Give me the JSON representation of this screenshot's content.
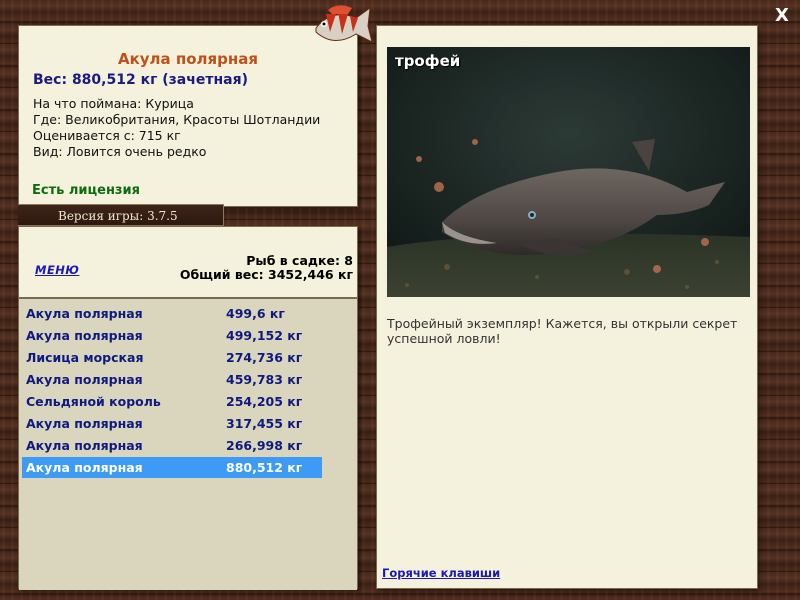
{
  "window": {
    "close_label": "X"
  },
  "logo": {
    "icon": "fish-logo-icon"
  },
  "info": {
    "title": "Акула полярная",
    "weight": "Вес: 880,512 кг (зачетная)",
    "bait": "На что поймана: Курица",
    "location": "Где: Великобритания, Красоты Шотландии",
    "valued_from": "Оценивается с: 715 кг",
    "species": "Вид: Ловится очень редко",
    "license": "Есть лицензия"
  },
  "version": "Версия игры: 3.7.5",
  "list_header": {
    "menu_label": "МЕНЮ",
    "fish_in_cage": "Рыб в садке: 8",
    "total_weight": "Общий вес: 3452,446 кг"
  },
  "catch_list": [
    {
      "name": "Акула полярная",
      "weight": "499,6 кг"
    },
    {
      "name": "Акула полярная",
      "weight": "499,152 кг"
    },
    {
      "name": "Лисица морская",
      "weight": "274,736 кг"
    },
    {
      "name": "Акула полярная",
      "weight": "459,783 кг"
    },
    {
      "name": "Сельдяной король",
      "weight": "254,205 кг"
    },
    {
      "name": "Акула полярная",
      "weight": "317,455 кг"
    },
    {
      "name": "Акула полярная",
      "weight": "266,998 кг"
    },
    {
      "name": "Акула полярная",
      "weight": "880,512 кг"
    }
  ],
  "selected_index": 7,
  "trophy": {
    "label": "трофей",
    "description": "Трофейный экземпляр! Кажется, вы открыли секрет успешной ловли!",
    "hotkeys": "Горячие клавиши"
  },
  "colors": {
    "title": "#c0501a",
    "accent_blue": "#1a1a80",
    "license_green": "#0f6b0f",
    "selection": "#3d9bf5"
  }
}
